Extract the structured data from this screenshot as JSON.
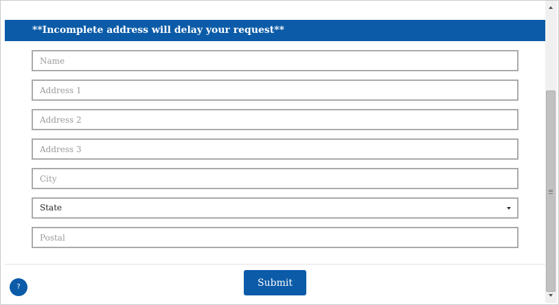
{
  "form": {
    "banner": "**Incomplete address will delay your request**",
    "fields": {
      "name": {
        "placeholder": "Name"
      },
      "address1": {
        "placeholder": "Address 1"
      },
      "address2": {
        "placeholder": "Address 2"
      },
      "address3": {
        "placeholder": "Address 3"
      },
      "city": {
        "placeholder": "City"
      },
      "state": {
        "selected": "State"
      },
      "postal": {
        "placeholder": "Postal"
      }
    },
    "submit_label": "Submit"
  },
  "help": {
    "label": "?"
  },
  "icons": {
    "state_dropdown": "caret-down-icon",
    "scroll_up": "arrow-up-icon",
    "scroll_down": "arrow-down-icon"
  },
  "colors": {
    "brand": "#0b5ba8",
    "border": "#a9a9a9",
    "placeholder": "#9a9a9a"
  }
}
